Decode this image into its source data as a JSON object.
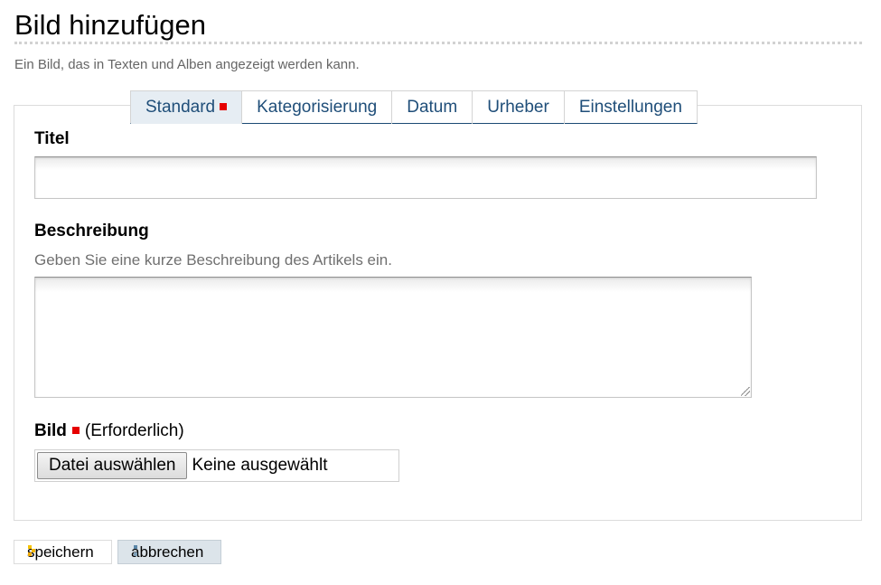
{
  "page": {
    "title": "Bild hinzufügen",
    "subtitle": "Ein Bild, das in Texten und Alben angezeigt werden kann."
  },
  "tabs": [
    {
      "label": "Standard",
      "active": true,
      "required": true
    },
    {
      "label": "Kategorisierung",
      "active": false
    },
    {
      "label": "Datum",
      "active": false
    },
    {
      "label": "Urheber",
      "active": false
    },
    {
      "label": "Einstellungen",
      "active": false
    }
  ],
  "form": {
    "title_field": {
      "label": "Titel",
      "value": ""
    },
    "description_field": {
      "label": "Beschreibung",
      "hint": "Geben Sie eine kurze Beschreibung des Artikels ein.",
      "value": ""
    },
    "image_field": {
      "label": "Bild",
      "required_text": "(Erforderlich)",
      "button_label": "Datei auswählen",
      "status": "Keine ausgewählt"
    }
  },
  "actions": {
    "save_label": "speichern",
    "cancel_label": "abbrechen"
  },
  "colors": {
    "required_marker": "#e60000",
    "tab_text": "#1f4e79",
    "tab_active_bg": "#e6edf3",
    "save_icon": "#f5b800",
    "cancel_icon": "#5a86a8"
  },
  "icons": {
    "save": "save-arrow-icon",
    "cancel": "cancel-icon"
  }
}
